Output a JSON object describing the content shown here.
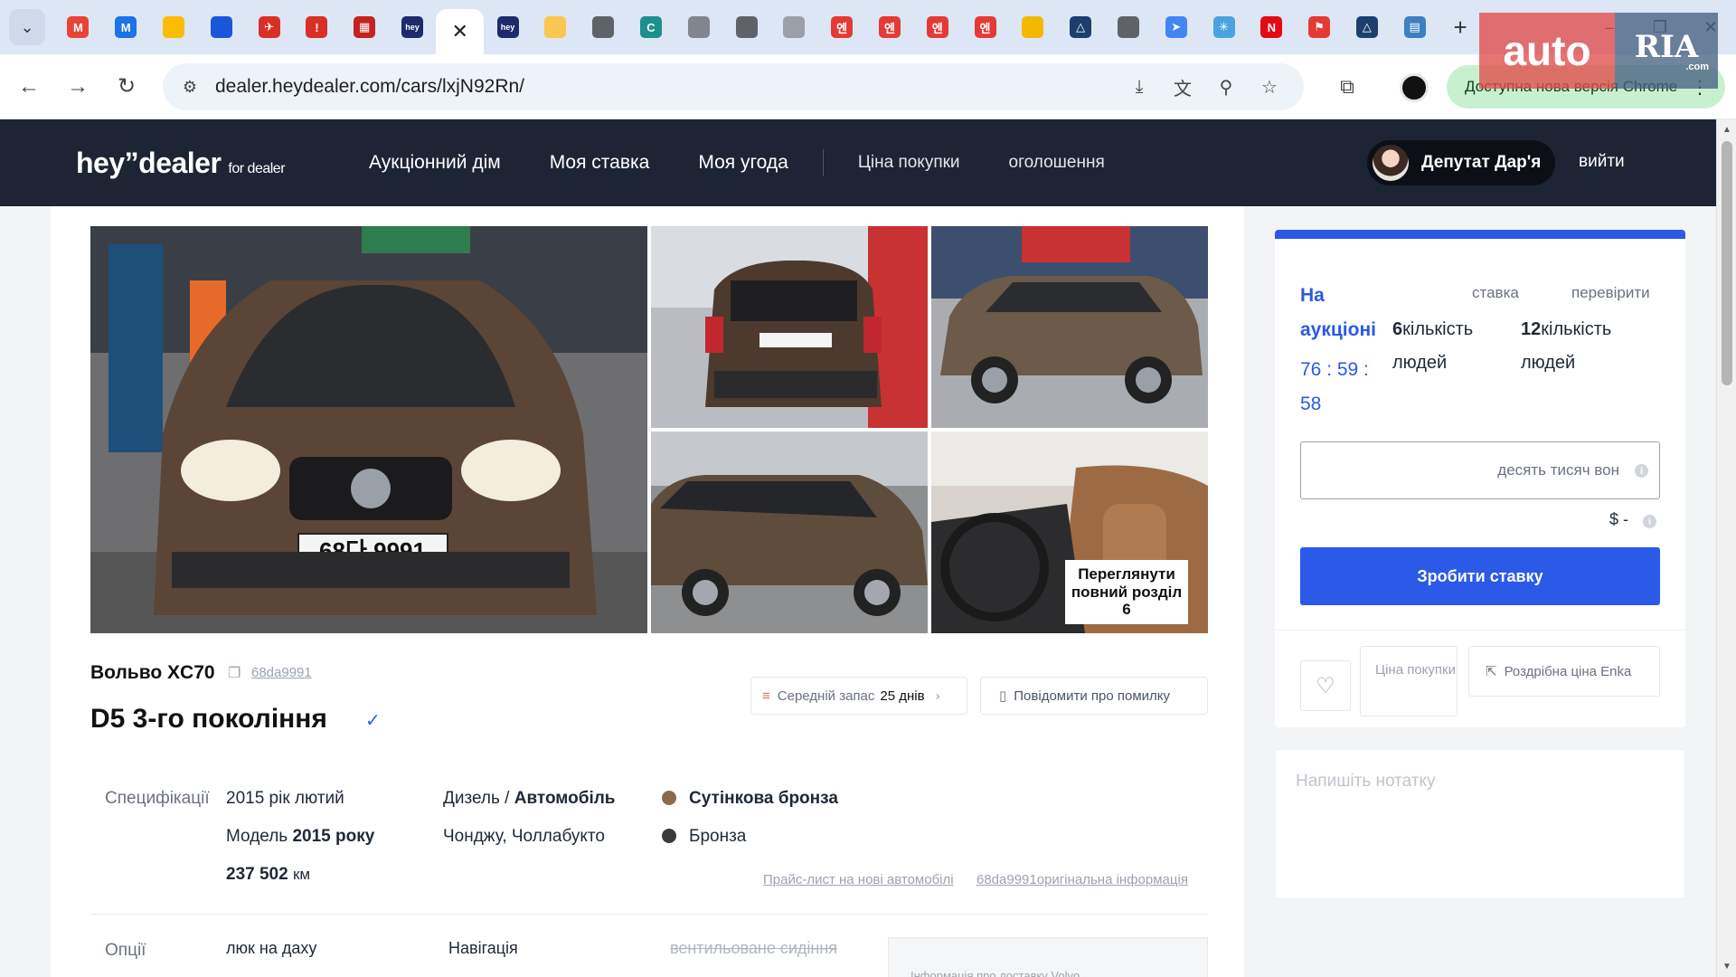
{
  "browser": {
    "tabs": [
      {
        "name": "tab-gmail",
        "glyph": "M",
        "color": "#ea4335"
      },
      {
        "name": "tab-mail",
        "glyph": "M",
        "color": "#1a73e8"
      },
      {
        "name": "tab-keep",
        "glyph": "",
        "color": "#fbbc04"
      },
      {
        "name": "tab-shield",
        "glyph": "",
        "color": "#1a56db"
      },
      {
        "name": "tab-plane",
        "glyph": "✈",
        "color": "#d93025"
      },
      {
        "name": "tab-triangle",
        "glyph": "!",
        "color": "#d93025"
      },
      {
        "name": "tab-grid",
        "glyph": "▦",
        "color": "#c5221f"
      },
      {
        "name": "tab-hey-1",
        "glyph": "hey",
        "color": "#1d2a6b"
      },
      {
        "name": "tab-active",
        "glyph": "✕",
        "color": "transparent",
        "active": true
      },
      {
        "name": "tab-hey-2",
        "glyph": "hey",
        "color": "#1d2a6b"
      },
      {
        "name": "tab-yellow",
        "glyph": "",
        "color": "#f9c74f"
      },
      {
        "name": "tab-globe-1",
        "glyph": "",
        "color": "#5f6368"
      },
      {
        "name": "tab-c",
        "glyph": "C",
        "color": "#1e8e8e"
      },
      {
        "name": "tab-search",
        "glyph": "",
        "color": "#80868b"
      },
      {
        "name": "tab-globe-2",
        "glyph": "",
        "color": "#5f6368"
      },
      {
        "name": "tab-doc",
        "glyph": "",
        "color": "#9aa0a6"
      },
      {
        "name": "tab-encar-1",
        "glyph": "엔",
        "color": "#e53935"
      },
      {
        "name": "tab-encar-2",
        "glyph": "엔",
        "color": "#e53935"
      },
      {
        "name": "tab-encar-3",
        "glyph": "엔",
        "color": "#e53935"
      },
      {
        "name": "tab-encar-4",
        "glyph": "엔",
        "color": "#e53935"
      },
      {
        "name": "tab-bar",
        "glyph": "",
        "color": "#f5b800"
      },
      {
        "name": "tab-delta-1",
        "glyph": "△",
        "color": "#1d3f6e"
      },
      {
        "name": "tab-globe-3",
        "glyph": "",
        "color": "#5f6368"
      },
      {
        "name": "tab-arrow",
        "glyph": "➤",
        "color": "#4285f4"
      },
      {
        "name": "tab-star",
        "glyph": "✳",
        "color": "#4aa3df"
      },
      {
        "name": "tab-n",
        "glyph": "N",
        "color": "#e50914"
      },
      {
        "name": "tab-flag",
        "glyph": "⚑",
        "color": "#e53935"
      },
      {
        "name": "tab-delta-2",
        "glyph": "△",
        "color": "#1d3f6e"
      },
      {
        "name": "tab-card",
        "glyph": "▤",
        "color": "#3d7fc1"
      }
    ],
    "url": "dealer.heydealer.com/cars/lxjN92Rn/",
    "update_text": "Доступна нова версія Chrome"
  },
  "watermark": {
    "left": "auto",
    "right": "RIA",
    "sub": ".com"
  },
  "header": {
    "logo": "hey”dealer",
    "logo_sub": "for dealer",
    "nav": [
      "Аукціонний дім",
      "Моя ставка",
      "Моя угода"
    ],
    "nav_secondary": [
      "Ціна покупки",
      "оголошення"
    ],
    "user": "Депутат Дар'я",
    "logout": "вийти"
  },
  "car": {
    "gallery_overlay": [
      "Переглянути",
      "повний розділ",
      "6"
    ],
    "make": "Вольво XC70",
    "plate": "68da9991",
    "plate_text_on_photo": "68다 9991",
    "model": "D5 3-го покоління",
    "avg_stock_label": "Середній запас",
    "avg_stock_value": "25 днів",
    "report_error": "Повідомити про помилку",
    "specs_label": "Специфікації",
    "specs": {
      "year": "2015 рік лютий",
      "model_year_prefix": "Модель",
      "model_year_value": "2015 року",
      "mileage": "237 502",
      "mileage_unit": "км",
      "fuel": "Дизель /",
      "body": "Автомобіль",
      "location": "Чонджу, Чоллабукто",
      "exterior_color": "Сутінкова бронза",
      "exterior_color_hex": "#8a6a4f",
      "interior_color": "Бронза",
      "interior_color_hex": "#3b3b3b"
    },
    "links": [
      "Прайс-лист на нові автомобілі",
      "68da9991оригінальна інформація"
    ],
    "options_label": "Опції",
    "options": [
      "люк на даху",
      "Навігація",
      "вентильоване сидіння"
    ],
    "volvo_box_text": "Інформація про доставку Volvo"
  },
  "auction": {
    "status": "На аукціоні",
    "timer": "76 : 59 : 58",
    "col_bid": "ставка",
    "col_check": "перевірити",
    "bid_count": "6",
    "check_count": "12",
    "count_unit": "кількість людей",
    "input_placeholder": "десять тисяч вон",
    "usd": "$ -",
    "bid_button": "Зробити ставку",
    "purchase_price": "Ціна покупки",
    "retail_price": "Роздрібна ціна Enka",
    "note_placeholder": "Напишіть нотатку"
  },
  "colors": {
    "accent": "#2b59e8",
    "header_bg": "#1d2433"
  }
}
